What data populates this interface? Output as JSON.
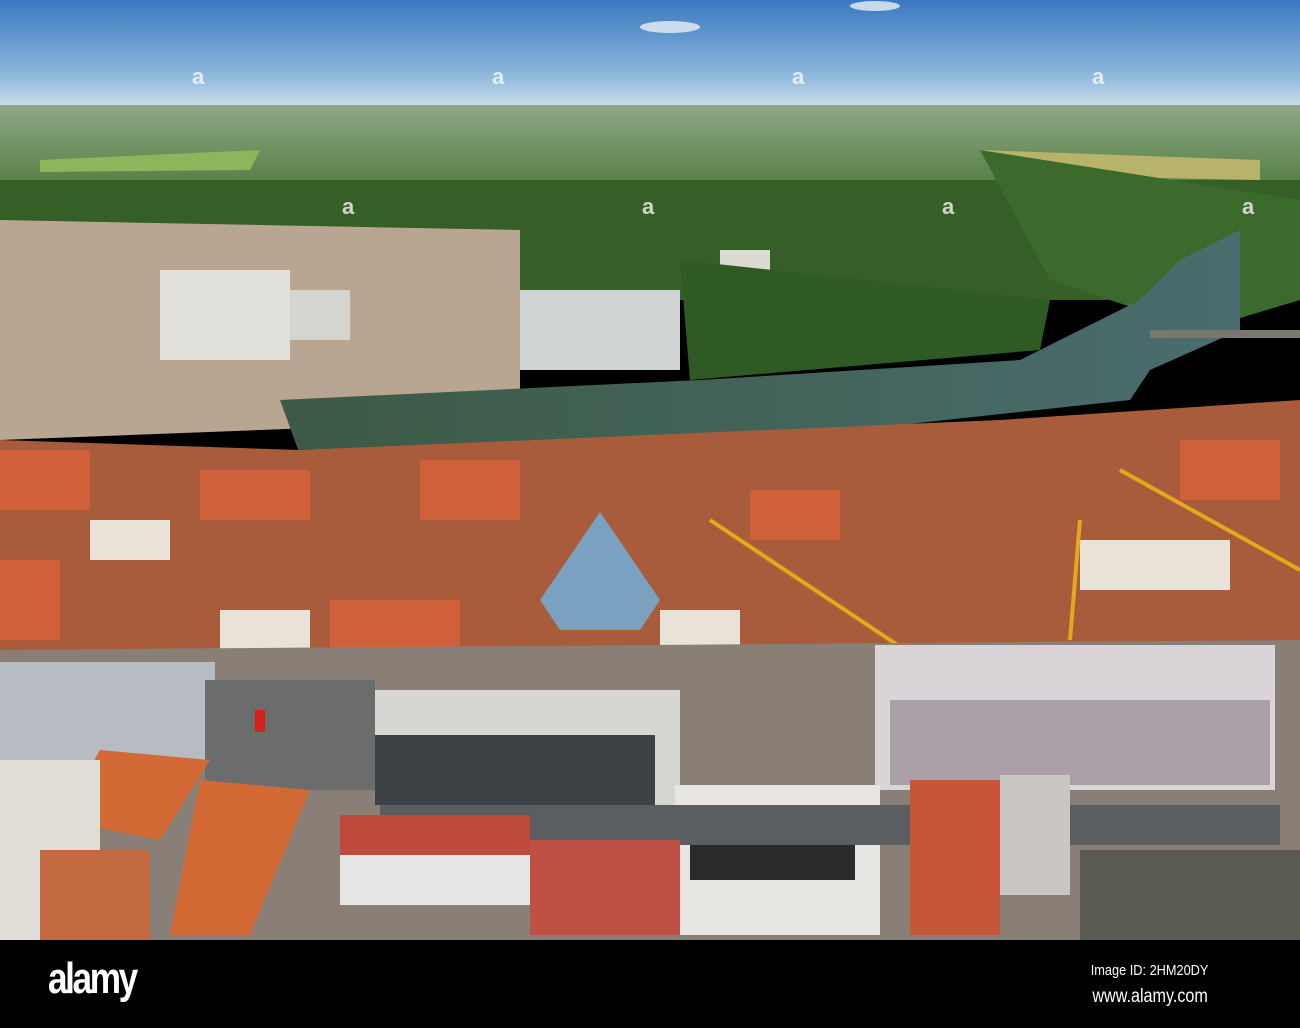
{
  "photo": {
    "subject": "aerial-city-river",
    "colors": {
      "sky_top": "#3f7fc4",
      "sky_horizon": "#c9dcea",
      "forest": "#2f5a22",
      "river": "#3d5a3a",
      "roof": "#c4582e",
      "roof_dark": "#7e3a28"
    }
  },
  "footer": {
    "logo": "alamy",
    "image_id": "Image ID: 2HM20DY",
    "website": "www.alamy.com"
  }
}
